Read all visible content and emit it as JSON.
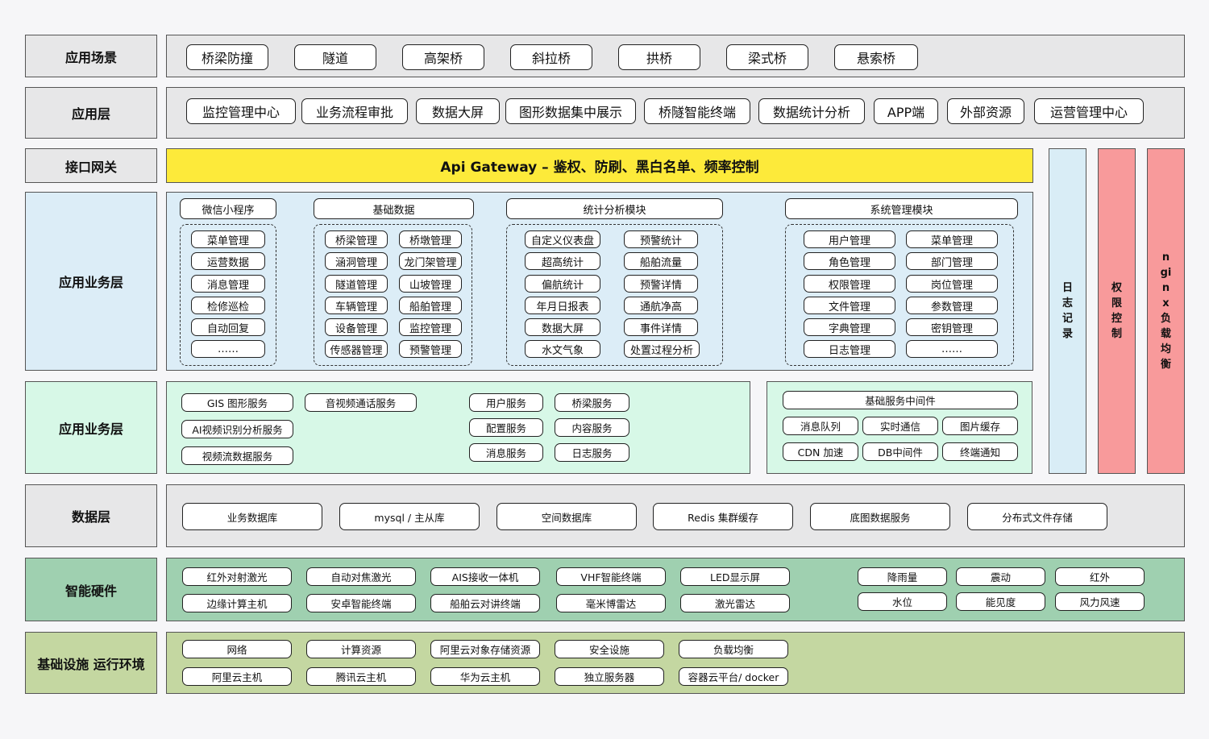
{
  "rows": {
    "scenario": {
      "label": "应用场景",
      "items": [
        "桥梁防撞",
        "隧道",
        "高架桥",
        "斜拉桥",
        "拱桥",
        "梁式桥",
        "悬索桥"
      ]
    },
    "app": {
      "label": "应用层",
      "items": [
        "监控管理中心",
        "业务流程审批",
        "数据大屏",
        "图形数据集中展示",
        "桥隧智能终端",
        "数据统计分析",
        "APP端",
        "外部资源",
        "运营管理中心"
      ]
    },
    "gateway": {
      "label": "接口网关",
      "text": "Api Gateway – 鉴权、防刷、黑白名单、频率控制"
    },
    "business1": {
      "label": "应用业务层",
      "groups": [
        {
          "title": "微信小程序",
          "items": [
            "菜单管理",
            "运营数据",
            "消息管理",
            "检修巡检",
            "自动回复",
            "……"
          ]
        },
        {
          "title": "基础数据",
          "items": [
            "桥梁管理",
            "桥墩管理",
            "涵洞管理",
            "龙门架管理",
            "隧道管理",
            "山坡管理",
            "车辆管理",
            "船舶管理",
            "设备管理",
            "监控管理",
            "传感器管理",
            "预警管理"
          ]
        },
        {
          "title": "统计分析模块",
          "items": [
            "自定义仪表盘",
            "预警统计",
            "超高统计",
            "船舶流量",
            "偏航统计",
            "预警详情",
            "年月日报表",
            "通航净高",
            "数据大屏",
            "事件详情",
            "水文气象",
            "处置过程分析"
          ]
        },
        {
          "title": "系统管理模块",
          "items": [
            "用户管理",
            "菜单管理",
            "角色管理",
            "部门管理",
            "权限管理",
            "岗位管理",
            "文件管理",
            "参数管理",
            "字典管理",
            "密钥管理",
            "日志管理",
            "……"
          ]
        }
      ]
    },
    "business2": {
      "label": "应用业务层",
      "left_items": [
        "GIS 图形服务",
        "音视频通话服务",
        "AI视频识别分析服务",
        "视频流数据服务",
        "用户服务",
        "桥梁服务",
        "配置服务",
        "内容服务",
        "消息服务",
        "日志服务"
      ],
      "middleware_title": "基础服务中间件",
      "middleware_items": [
        "消息队列",
        "实时通信",
        "图片缓存",
        "CDN 加速",
        "DB中间件",
        "终端通知"
      ]
    },
    "data": {
      "label": "数据层",
      "items": [
        "业务数据库",
        "mysql / 主从库",
        "空间数据库",
        "Redis 集群缓存",
        "底图数据服务",
        "分布式文件存储"
      ]
    },
    "hardware": {
      "label": "智能硬件",
      "items": [
        "红外对射激光",
        "自动对焦激光",
        "AIS接收一体机",
        "VHF智能终端",
        "LED显示屏",
        "边缘计算主机",
        "安卓智能终端",
        "船舶云对讲终端",
        "毫米博雷达",
        "激光雷达",
        "降雨量",
        "震动",
        "红外",
        "水位",
        "能见度",
        "风力风速"
      ]
    },
    "infra": {
      "label": "基础设施 运行环境",
      "items": [
        "网络",
        "计算资源",
        "阿里云对象存储资源",
        "安全设施",
        "负载均衡",
        "阿里云主机",
        "腾讯云主机",
        "华为云主机",
        "独立服务器",
        "容器云平台/ docker"
      ]
    }
  },
  "side": {
    "log": "日志记录",
    "auth": "权限控制",
    "nginx": "nginx负载均衡"
  },
  "colors": {
    "gray": "#e7e7e8",
    "blue": "#dcedf7",
    "mint": "#d7f8e7",
    "green": "#9fd0b0",
    "olive": "#c4d7a1",
    "yellow": "#fdea3a",
    "pink": "#f89a9b",
    "lightblue": "#d9edf6"
  }
}
